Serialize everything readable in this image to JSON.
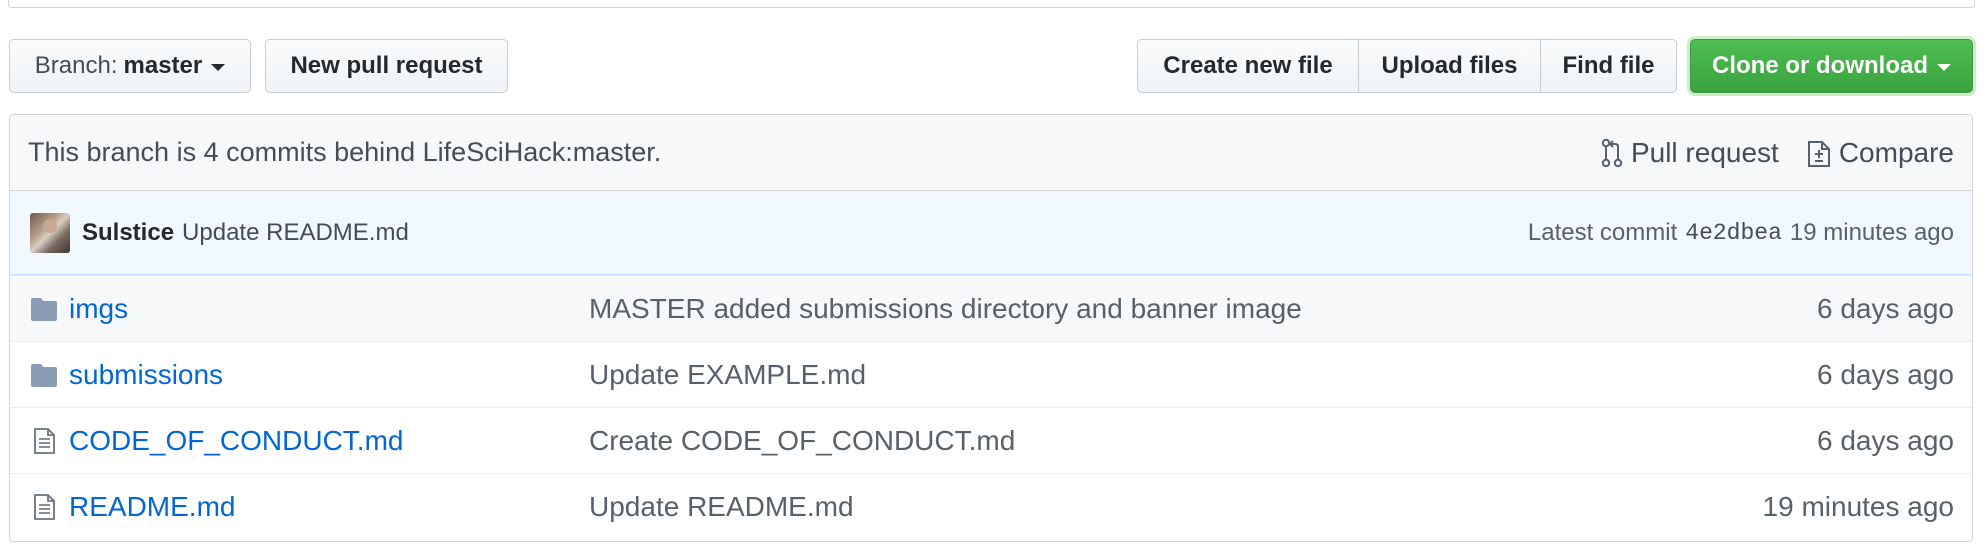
{
  "toolbar": {
    "branch_prefix": "Branch:",
    "branch_name": "master",
    "new_pull_request": "New pull request",
    "create_new_file": "Create new file",
    "upload_files": "Upload files",
    "find_file": "Find file",
    "clone_or_download": "Clone or download"
  },
  "branch_status": {
    "text": "This branch is 4 commits behind LifeSciHack:master.",
    "pull_request": "Pull request",
    "compare": "Compare"
  },
  "latest_commit": {
    "author": "Sulstice",
    "message": "Update README.md",
    "label": "Latest commit",
    "sha": "4e2dbea",
    "age": "19 minutes ago"
  },
  "files": [
    {
      "type": "folder",
      "icon": "folder-icon",
      "name": "imgs",
      "message": "MASTER added submissions directory and banner image",
      "age": "6 days ago"
    },
    {
      "type": "folder",
      "icon": "folder-icon",
      "name": "submissions",
      "message": "Update EXAMPLE.md",
      "age": "6 days ago"
    },
    {
      "type": "file",
      "icon": "file-icon",
      "name": "CODE_OF_CONDUCT.md",
      "message": "Create CODE_OF_CONDUCT.md",
      "age": "6 days ago"
    },
    {
      "type": "file",
      "icon": "file-icon",
      "name": "README.md",
      "message": "Update README.md",
      "age": "19 minutes ago"
    }
  ],
  "colors": {
    "link": "#0366d6",
    "clone_button": "#3ba33f",
    "folder_icon": "#79b8ff",
    "commit_bar_bg": "#f1f8ff"
  }
}
